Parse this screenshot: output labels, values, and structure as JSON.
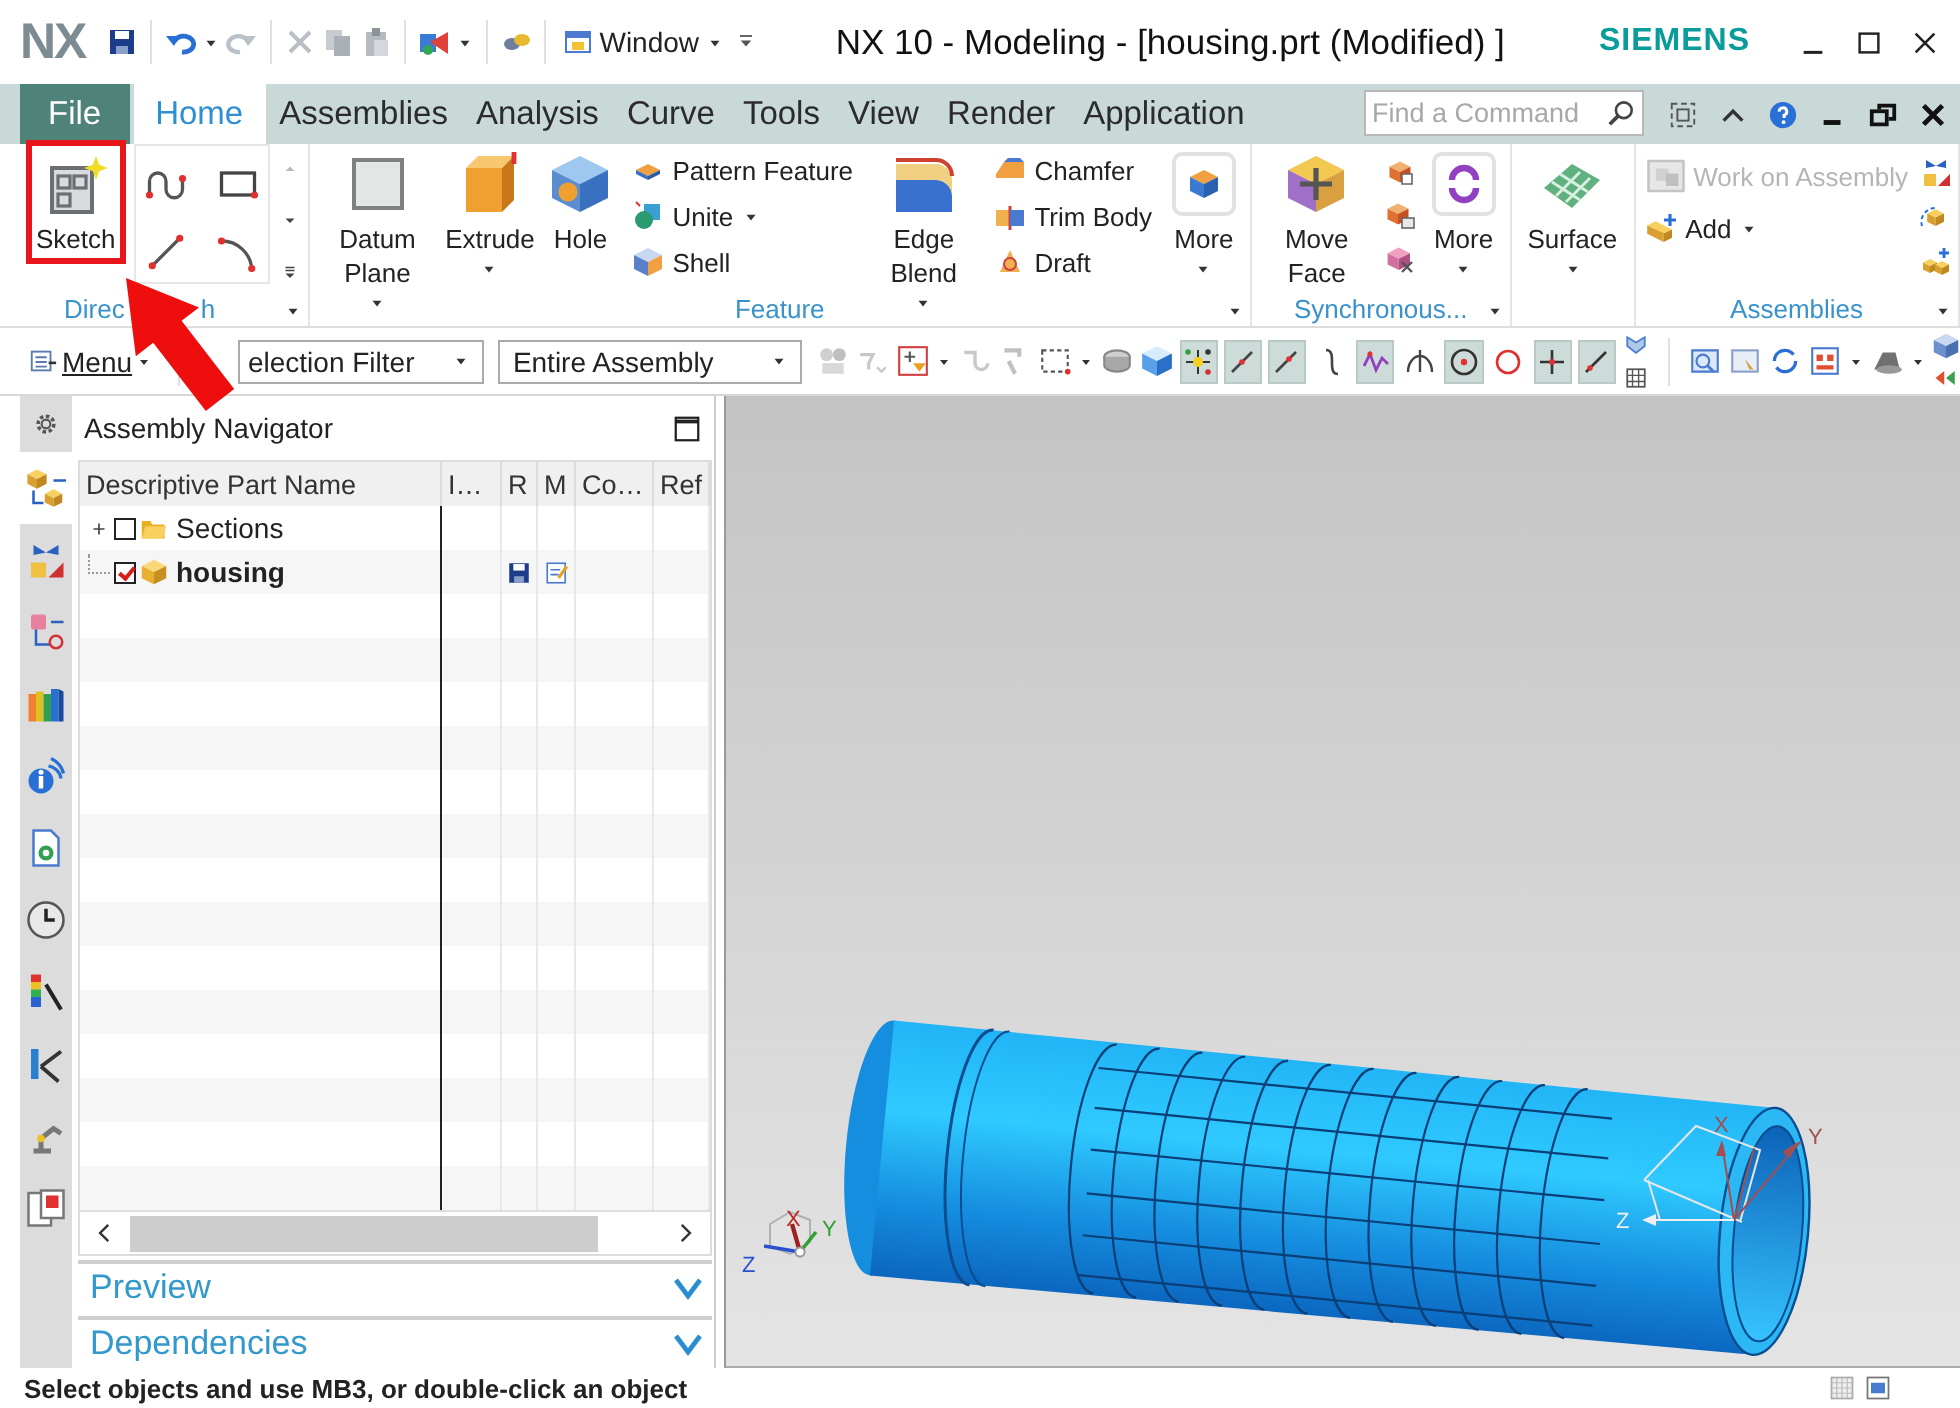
{
  "title_bar": {
    "logo": "NX",
    "window_menu": "Window",
    "title": "NX 10 - Modeling - [housing.prt (Modified) ]",
    "brand": "SIEMENS"
  },
  "menu_tabs": [
    {
      "label": "File",
      "kind": "file",
      "selected": false
    },
    {
      "label": "Home",
      "kind": "tab",
      "selected": true
    },
    {
      "label": "Assemblies",
      "kind": "tab",
      "selected": false
    },
    {
      "label": "Analysis",
      "kind": "tab",
      "selected": false
    },
    {
      "label": "Curve",
      "kind": "tab",
      "selected": false
    },
    {
      "label": "Tools",
      "kind": "tab",
      "selected": false
    },
    {
      "label": "View",
      "kind": "tab",
      "selected": false
    },
    {
      "label": "Render",
      "kind": "tab",
      "selected": false
    },
    {
      "label": "Application",
      "kind": "tab",
      "selected": false
    }
  ],
  "command_search": {
    "placeholder": "Find a Command"
  },
  "ribbon_groups": [
    {
      "label": "Direc",
      "label_end": "h",
      "launcher": true,
      "columns": [
        {
          "kind": "large",
          "label": "Sketch",
          "highlighted": true
        },
        {
          "kind": "icon_grid"
        },
        {
          "kind": "gallery_scroll"
        }
      ]
    },
    {
      "label": "Feature",
      "launcher": true,
      "columns": [
        {
          "kind": "large",
          "label": "Datum Plane",
          "dropdown": true,
          "highlighted": false
        },
        {
          "kind": "large",
          "label": "Extrude",
          "dropdown": true,
          "highlighted": false
        },
        {
          "kind": "large",
          "label": "Hole",
          "highlighted": false
        },
        {
          "kind": "stack",
          "items": [
            {
              "label": "Pattern Feature",
              "disabled": false
            },
            {
              "label": "Unite",
              "dropdown": true,
              "disabled": false
            },
            {
              "label": "Shell",
              "disabled": false
            }
          ]
        },
        {
          "kind": "large",
          "label": "Edge Blend",
          "dropdown": true,
          "highlighted": false
        },
        {
          "kind": "stack",
          "items": [
            {
              "label": "Chamfer",
              "disabled": false
            },
            {
              "label": "Trim Body",
              "disabled": false
            },
            {
              "label": "Draft",
              "disabled": false
            }
          ]
        },
        {
          "kind": "large",
          "label": "More",
          "dropdown": true,
          "highlighted": false
        }
      ]
    },
    {
      "label": "Synchronous...",
      "launcher": true,
      "columns": [
        {
          "kind": "large",
          "label": "Move Face",
          "highlighted": false
        },
        {
          "kind": "icon_stack"
        },
        {
          "kind": "large",
          "label": "More",
          "dropdown": true,
          "highlighted": false
        }
      ]
    },
    {
      "columns": [
        {
          "kind": "large",
          "label": "Surface",
          "dropdown": true,
          "highlighted": false
        }
      ]
    },
    {
      "label": "Assemblies",
      "launcher": true,
      "columns": [
        {
          "kind": "stack",
          "items": [
            {
              "label": "Work on Assembly",
              "disabled": true
            },
            {
              "label": "Add",
              "dropdown": true,
              "disabled": false
            }
          ]
        },
        {
          "kind": "icon_stack"
        }
      ]
    }
  ],
  "selection_bar": {
    "menu": "Menu",
    "filter": "election Filter",
    "scope": "Entire Assembly",
    "snap_buttons": [
      {
        "on": true
      },
      {
        "on": true
      },
      {
        "on": true
      },
      {
        "on": false
      },
      {
        "on": true
      },
      {
        "on": false
      },
      {
        "on": true
      },
      {
        "on": false
      },
      {
        "on": true
      },
      {
        "on": true
      }
    ]
  },
  "resource_bar": [
    {
      "selected": false
    },
    {
      "selected": true
    },
    {
      "selected": false
    },
    {
      "selected": false
    },
    {
      "selected": false
    },
    {
      "selected": false
    },
    {
      "selected": false
    },
    {
      "selected": false
    },
    {
      "selected": false
    },
    {
      "selected": false
    },
    {
      "selected": false
    },
    {
      "selected": false
    }
  ],
  "assembly_navigator": {
    "title": "Assembly Navigator",
    "columns": [
      "Descriptive Part Name",
      "I…",
      "R",
      "M",
      "Co…",
      "Ref"
    ],
    "rows": [
      {
        "label": "Sections",
        "kind": "folder",
        "expandable": true,
        "expanded": false,
        "checked": false,
        "work_part": false,
        "writable": false,
        "modified": false
      },
      {
        "label": "housing",
        "kind": "part",
        "expandable": false,
        "checked": true,
        "work_part": true,
        "writable": true,
        "modified": true
      }
    ]
  },
  "panels": [
    {
      "label": "Preview",
      "expanded": false
    },
    {
      "label": "Dependencies",
      "expanded": false
    }
  ],
  "viewport": {
    "triad_labels": [
      "X",
      "Y",
      "Z"
    ],
    "wcs_labels": [
      "X",
      "Y",
      "Z"
    ]
  },
  "status_bar": {
    "message": "Select objects and use MB3, or double-click an object"
  },
  "annotations": [
    {
      "kind": "arrow"
    }
  ]
}
